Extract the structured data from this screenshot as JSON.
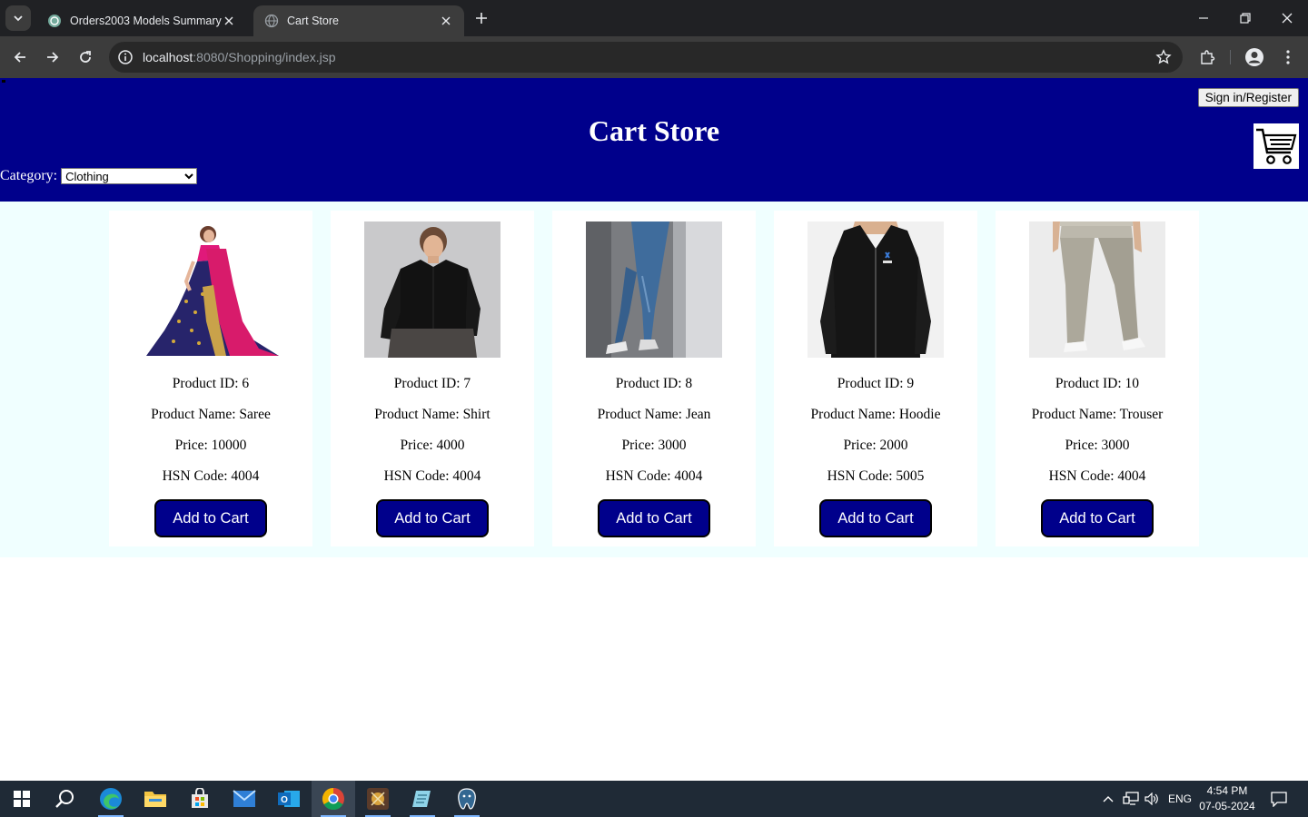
{
  "browser": {
    "tabs": [
      {
        "title": "Orders2003 Models Summary",
        "favicon": "chatgpt-icon",
        "active": false
      },
      {
        "title": "Cart Store",
        "favicon": "globe-icon",
        "active": true
      }
    ],
    "url_host": "localhost",
    "url_rest": ":8080/Shopping/index.jsp"
  },
  "page": {
    "title": "Cart Store",
    "signin_label": "Sign in/Register",
    "category_label": "Category:",
    "category_selected": "Clothing",
    "header_color": "#00008b",
    "products_bg": "#f0ffff",
    "products": [
      {
        "id_text": "Product ID: 6",
        "name_text": "Product Name: Saree",
        "price_text": "Price: 10000",
        "hsn_text": "HSN Code: 4004",
        "button": "Add to Cart",
        "image": "saree-image"
      },
      {
        "id_text": "Product ID: 7",
        "name_text": "Product Name: Shirt",
        "price_text": "Price: 4000",
        "hsn_text": "HSN Code: 4004",
        "button": "Add to Cart",
        "image": "shirt-image"
      },
      {
        "id_text": "Product ID: 8",
        "name_text": "Product Name: Jean",
        "price_text": "Price: 3000",
        "hsn_text": "HSN Code: 4004",
        "button": "Add to Cart",
        "image": "jean-image"
      },
      {
        "id_text": "Product ID: 9",
        "name_text": "Product Name: Hoodie",
        "price_text": "Price: 2000",
        "hsn_text": "HSN Code: 5005",
        "button": "Add to Cart",
        "image": "hoodie-image"
      },
      {
        "id_text": "Product ID: 10",
        "name_text": "Product Name: Trouser",
        "price_text": "Price: 3000",
        "hsn_text": "HSN Code: 4004",
        "button": "Add to Cart",
        "image": "trouser-image"
      }
    ]
  },
  "taskbar": {
    "language": "ENG",
    "time": "4:54 PM",
    "date": "07-05-2024",
    "apps": [
      "start-icon",
      "search-icon",
      "edge-icon",
      "file-explorer-icon",
      "store-icon",
      "mail-icon",
      "outlook-icon",
      "chrome-icon",
      "game-app-icon",
      "notepad-icon",
      "pgadmin-icon"
    ]
  }
}
